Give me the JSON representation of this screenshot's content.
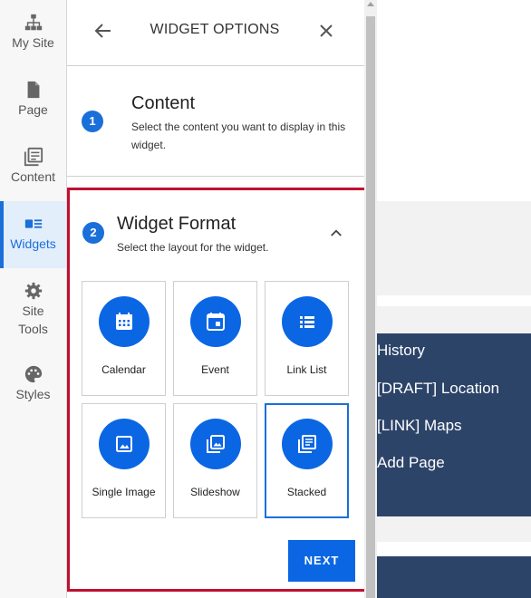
{
  "sidebar": {
    "items": [
      {
        "label": "My Site",
        "icon": "sitemap-icon"
      },
      {
        "label": "Page",
        "icon": "page-icon"
      },
      {
        "label": "Content",
        "icon": "content-icon"
      },
      {
        "label": "Widgets",
        "icon": "widgets-icon",
        "active": true
      },
      {
        "label": "Site",
        "label2": "Tools",
        "icon": "gear-icon"
      },
      {
        "label": "Styles",
        "icon": "palette-icon"
      }
    ]
  },
  "panel": {
    "title": "WIDGET OPTIONS",
    "step1": {
      "number": "1",
      "title": "Content",
      "description": "Select the content you want to display in this widget."
    },
    "step2": {
      "number": "2",
      "title": "Widget Format",
      "description": "Select the layout for the widget."
    },
    "tiles": [
      {
        "label": "Calendar",
        "icon": "calendar-icon"
      },
      {
        "label": "Event",
        "icon": "event-icon"
      },
      {
        "label": "Link List",
        "icon": "list-icon"
      },
      {
        "label": "Single Image",
        "icon": "image-icon"
      },
      {
        "label": "Slideshow",
        "icon": "slideshow-icon"
      },
      {
        "label": "Stacked",
        "icon": "stacked-icon",
        "selected": true
      }
    ],
    "next_label": "NEXT"
  },
  "background_nav": [
    "History",
    "[DRAFT] Location",
    "[LINK] Maps",
    "Add Page"
  ],
  "colors": {
    "accent": "#0b66e4",
    "highlight_border": "#c0102f",
    "nav_bg": "#2d4469"
  }
}
